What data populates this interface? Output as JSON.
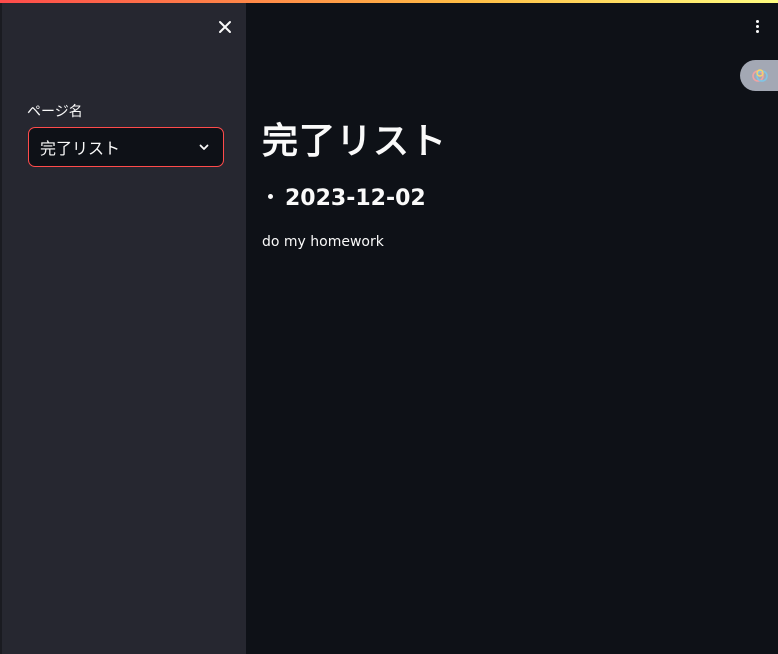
{
  "sidebar": {
    "close_icon": "close-icon",
    "select_label": "ページ名",
    "select_value": "完了リスト",
    "select_icon": "chevron-down-icon"
  },
  "header": {
    "menu_icon": "kebab-menu-icon",
    "status_icon": "running-status-icon"
  },
  "main": {
    "title": "完了リスト",
    "entries": [
      {
        "date": "2023-12-02",
        "task": "do my homework"
      }
    ]
  },
  "colors": {
    "accent": "#ff4b4b",
    "sidebar_bg": "#262730",
    "main_bg": "#0e1117",
    "text": "#fafafa"
  }
}
